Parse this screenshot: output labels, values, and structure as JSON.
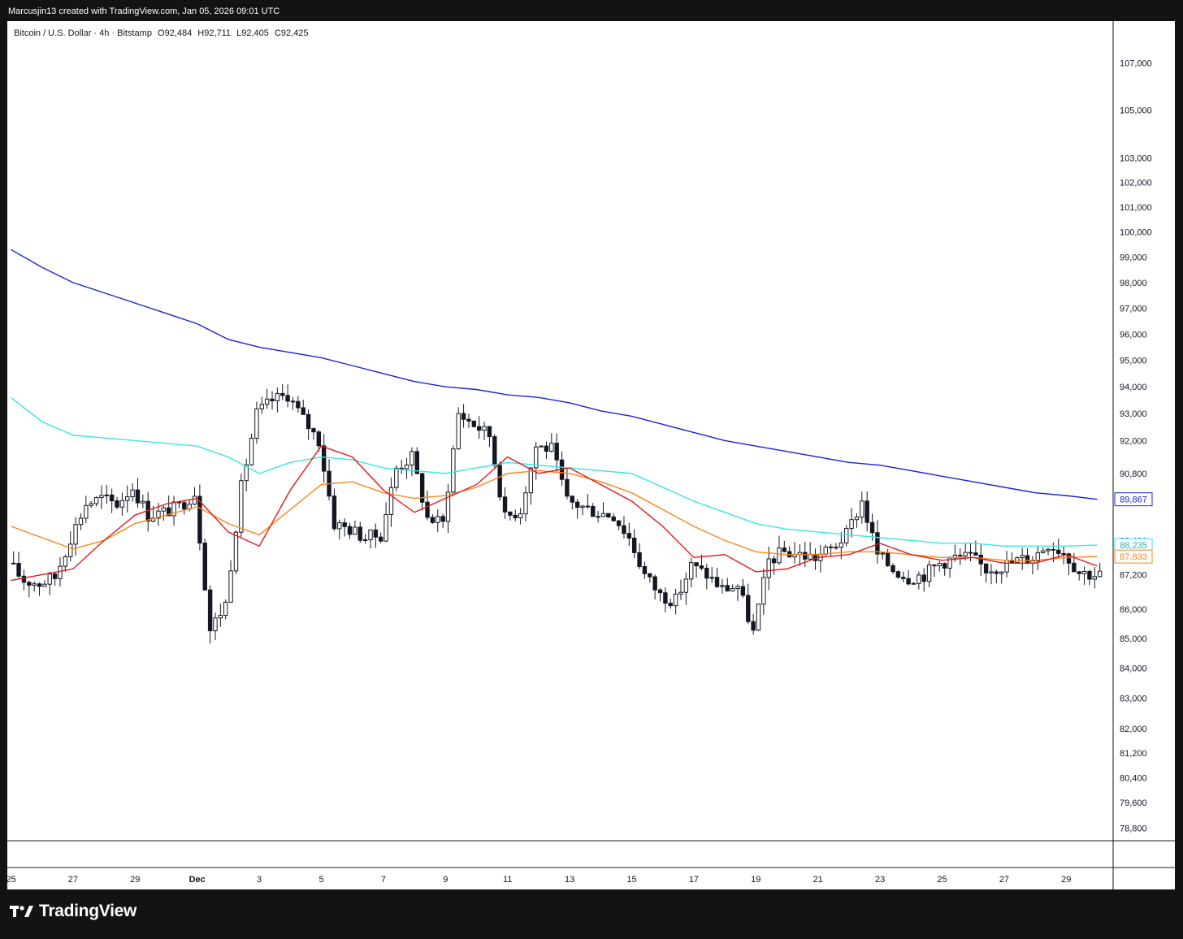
{
  "header": {
    "credit": "Marcusjin13 created with TradingView.com, Jan 05, 2026 09:01 UTC"
  },
  "legend": {
    "symbol": "Bitcoin / U.S. Dollar · 4h · Bitstamp",
    "open": "O92,484",
    "high": "H92,711",
    "low": "L92,405",
    "close": "C92,425"
  },
  "footer": {
    "brand": "TradingView"
  },
  "colors": {
    "candle": "#131722",
    "ema_blue": "#1a23d6",
    "ema_cyan": "#38e6e6",
    "ema_orange": "#f7861c",
    "ema_red": "#e31919"
  },
  "chart_data": {
    "type": "candlestick",
    "scale": "log",
    "ylim": [
      78400,
      108800
    ],
    "y_ticks": [
      107000,
      105000,
      103000,
      102000,
      101000,
      100000,
      99000,
      98000,
      97000,
      96000,
      95000,
      94000,
      93000,
      92000,
      90800,
      88400,
      87200,
      86000,
      85000,
      84000,
      83000,
      82000,
      81200,
      80400,
      79600,
      78800
    ],
    "y_tick_labels": [
      "107,000",
      "105,000",
      "103,000",
      "102,000",
      "101,000",
      "100,000",
      "99,000",
      "98,000",
      "97,000",
      "96,000",
      "95,000",
      "94,000",
      "93,000",
      "92,000",
      "90,800",
      "88,400",
      "87,200",
      "86,000",
      "85,000",
      "84,000",
      "83,000",
      "82,000",
      "81,200",
      "80,400",
      "79,600",
      "78,800"
    ],
    "x_labels": [
      "25",
      "27",
      "29",
      "Dec",
      "3",
      "5",
      "7",
      "9",
      "11",
      "13",
      "15",
      "17",
      "19",
      "21",
      "23",
      "25",
      "27",
      "29"
    ],
    "x_label_days": [
      0,
      2,
      4,
      6,
      8,
      10,
      12,
      14,
      16,
      18,
      20,
      22,
      24,
      26,
      28,
      30,
      32,
      34
    ],
    "anchors": [
      [
        0,
        87600
      ],
      [
        0.5,
        87000
      ],
      [
        1,
        86900
      ],
      [
        1.5,
        87100
      ],
      [
        2,
        88500
      ],
      [
        2.5,
        89700
      ],
      [
        3,
        89900
      ],
      [
        3.5,
        89700
      ],
      [
        4,
        90300
      ],
      [
        4.5,
        89300
      ],
      [
        5,
        89400
      ],
      [
        5.5,
        89600
      ],
      [
        6,
        90100
      ],
      [
        6.5,
        85300
      ],
      [
        7,
        86200
      ],
      [
        7.5,
        90300
      ],
      [
        8,
        93000
      ],
      [
        8.5,
        93500
      ],
      [
        9,
        93700
      ],
      [
        9.5,
        92800
      ],
      [
        10,
        92000
      ],
      [
        10.5,
        89000
      ],
      [
        11,
        88800
      ],
      [
        11.5,
        88500
      ],
      [
        12,
        88600
      ],
      [
        12.5,
        91000
      ],
      [
        13,
        91400
      ],
      [
        13.5,
        89200
      ],
      [
        14,
        89000
      ],
      [
        14.5,
        93000
      ],
      [
        15,
        92600
      ],
      [
        15.5,
        92200
      ],
      [
        16,
        89200
      ],
      [
        16.5,
        89500
      ],
      [
        17,
        91800
      ],
      [
        17.5,
        91700
      ],
      [
        18,
        89800
      ],
      [
        18.5,
        89600
      ],
      [
        19,
        89400
      ],
      [
        19.5,
        89300
      ],
      [
        20,
        88500
      ],
      [
        20.5,
        87200
      ],
      [
        21,
        86500
      ],
      [
        21.5,
        86300
      ],
      [
        22,
        87500
      ],
      [
        22.5,
        87200
      ],
      [
        23,
        86700
      ],
      [
        23.5,
        86800
      ],
      [
        24,
        85200
      ],
      [
        24.5,
        87700
      ],
      [
        25,
        88000
      ],
      [
        25.5,
        87900
      ],
      [
        26,
        87800
      ],
      [
        26.5,
        88100
      ],
      [
        27,
        88600
      ],
      [
        27.5,
        89800
      ],
      [
        28,
        87900
      ],
      [
        28.5,
        87400
      ],
      [
        29,
        87100
      ],
      [
        29.5,
        87200
      ],
      [
        30,
        87600
      ],
      [
        30.5,
        87800
      ],
      [
        31,
        87800
      ],
      [
        31.5,
        87400
      ],
      [
        32,
        87500
      ],
      [
        32.5,
        87700
      ],
      [
        33,
        87800
      ],
      [
        33.5,
        88300
      ],
      [
        34,
        88000
      ],
      [
        34.5,
        87300
      ],
      [
        35,
        87200
      ]
    ],
    "candles_per_day": 6,
    "days": 35.2,
    "moving_averages": [
      {
        "color": "#1a23d6",
        "points": [
          [
            0,
            99300
          ],
          [
            1,
            98600
          ],
          [
            2,
            98000
          ],
          [
            3,
            97600
          ],
          [
            4,
            97200
          ],
          [
            5,
            96800
          ],
          [
            6,
            96400
          ],
          [
            7,
            95800
          ],
          [
            8,
            95500
          ],
          [
            9,
            95300
          ],
          [
            10,
            95100
          ],
          [
            11,
            94800
          ],
          [
            12,
            94500
          ],
          [
            13,
            94200
          ],
          [
            14,
            94000
          ],
          [
            15,
            93900
          ],
          [
            16,
            93700
          ],
          [
            17,
            93600
          ],
          [
            18,
            93400
          ],
          [
            19,
            93100
          ],
          [
            20,
            92900
          ],
          [
            21,
            92600
          ],
          [
            22,
            92300
          ],
          [
            23,
            92000
          ],
          [
            24,
            91800
          ],
          [
            25,
            91600
          ],
          [
            26,
            91400
          ],
          [
            27,
            91200
          ],
          [
            28,
            91100
          ],
          [
            29,
            90900
          ],
          [
            30,
            90700
          ],
          [
            31,
            90500
          ],
          [
            32,
            90300
          ],
          [
            33,
            90100
          ],
          [
            34,
            90000
          ],
          [
            35,
            89867
          ]
        ]
      },
      {
        "color": "#38e6e6",
        "points": [
          [
            0,
            93600
          ],
          [
            1,
            92700
          ],
          [
            2,
            92200
          ],
          [
            3,
            92100
          ],
          [
            4,
            92000
          ],
          [
            5,
            91900
          ],
          [
            6,
            91800
          ],
          [
            7,
            91400
          ],
          [
            8,
            90800
          ],
          [
            9,
            91200
          ],
          [
            10,
            91400
          ],
          [
            11,
            91300
          ],
          [
            12,
            91000
          ],
          [
            13,
            90900
          ],
          [
            14,
            90800
          ],
          [
            15,
            91000
          ],
          [
            16,
            91200
          ],
          [
            17,
            91100
          ],
          [
            18,
            91000
          ],
          [
            19,
            90900
          ],
          [
            20,
            90800
          ],
          [
            21,
            90300
          ],
          [
            22,
            89800
          ],
          [
            23,
            89400
          ],
          [
            24,
            89000
          ],
          [
            25,
            88800
          ],
          [
            26,
            88700
          ],
          [
            27,
            88600
          ],
          [
            28,
            88500
          ],
          [
            29,
            88400
          ],
          [
            30,
            88300
          ],
          [
            31,
            88300
          ],
          [
            32,
            88200
          ],
          [
            33,
            88200
          ],
          [
            34,
            88200
          ],
          [
            35,
            88235
          ]
        ]
      },
      {
        "color": "#f7861c",
        "points": [
          [
            0,
            88900
          ],
          [
            1,
            88500
          ],
          [
            2,
            88100
          ],
          [
            3,
            88400
          ],
          [
            4,
            89000
          ],
          [
            5,
            89300
          ],
          [
            6,
            89600
          ],
          [
            7,
            89000
          ],
          [
            8,
            88600
          ],
          [
            9,
            89500
          ],
          [
            10,
            90400
          ],
          [
            11,
            90500
          ],
          [
            12,
            90100
          ],
          [
            13,
            89900
          ],
          [
            14,
            90000
          ],
          [
            15,
            90300
          ],
          [
            16,
            90800
          ],
          [
            17,
            90900
          ],
          [
            18,
            90800
          ],
          [
            19,
            90500
          ],
          [
            20,
            90100
          ],
          [
            21,
            89500
          ],
          [
            22,
            88900
          ],
          [
            23,
            88400
          ],
          [
            24,
            88000
          ],
          [
            25,
            87900
          ],
          [
            26,
            87900
          ],
          [
            27,
            88000
          ],
          [
            28,
            88000
          ],
          [
            29,
            87900
          ],
          [
            30,
            87800
          ],
          [
            31,
            87800
          ],
          [
            32,
            87700
          ],
          [
            33,
            87700
          ],
          [
            34,
            87800
          ],
          [
            35,
            87833
          ]
        ]
      },
      {
        "color": "#e31919",
        "points": [
          [
            0,
            87000
          ],
          [
            1,
            87200
          ],
          [
            2,
            87400
          ],
          [
            3,
            88400
          ],
          [
            4,
            89300
          ],
          [
            5,
            89700
          ],
          [
            6,
            89900
          ],
          [
            7,
            88700
          ],
          [
            8,
            88200
          ],
          [
            9,
            90200
          ],
          [
            10,
            91800
          ],
          [
            11,
            91400
          ],
          [
            12,
            90200
          ],
          [
            13,
            89400
          ],
          [
            14,
            89900
          ],
          [
            15,
            90400
          ],
          [
            16,
            91400
          ],
          [
            17,
            90800
          ],
          [
            18,
            91000
          ],
          [
            19,
            90400
          ],
          [
            20,
            89800
          ],
          [
            21,
            88900
          ],
          [
            22,
            87800
          ],
          [
            23,
            87900
          ],
          [
            24,
            87300
          ],
          [
            25,
            87400
          ],
          [
            26,
            87800
          ],
          [
            27,
            87900
          ],
          [
            28,
            88300
          ],
          [
            29,
            87900
          ],
          [
            30,
            87700
          ],
          [
            31,
            87800
          ],
          [
            32,
            87600
          ],
          [
            33,
            87600
          ],
          [
            34,
            87900
          ],
          [
            35,
            87500
          ]
        ]
      }
    ],
    "price_badges": [
      {
        "label": "89,867",
        "value": 89867,
        "bg": "#ffffff",
        "border": "#1a23d6",
        "text": "#1a23d6"
      },
      {
        "label": "88,235",
        "value": 88235,
        "bg": "#ffffff",
        "border": "#38e6e6",
        "text": "#13b8c4"
      },
      {
        "label": "87,833",
        "value": 87833,
        "bg": "#ffffff",
        "border": "#f7861c",
        "text": "#f7861c"
      }
    ]
  }
}
